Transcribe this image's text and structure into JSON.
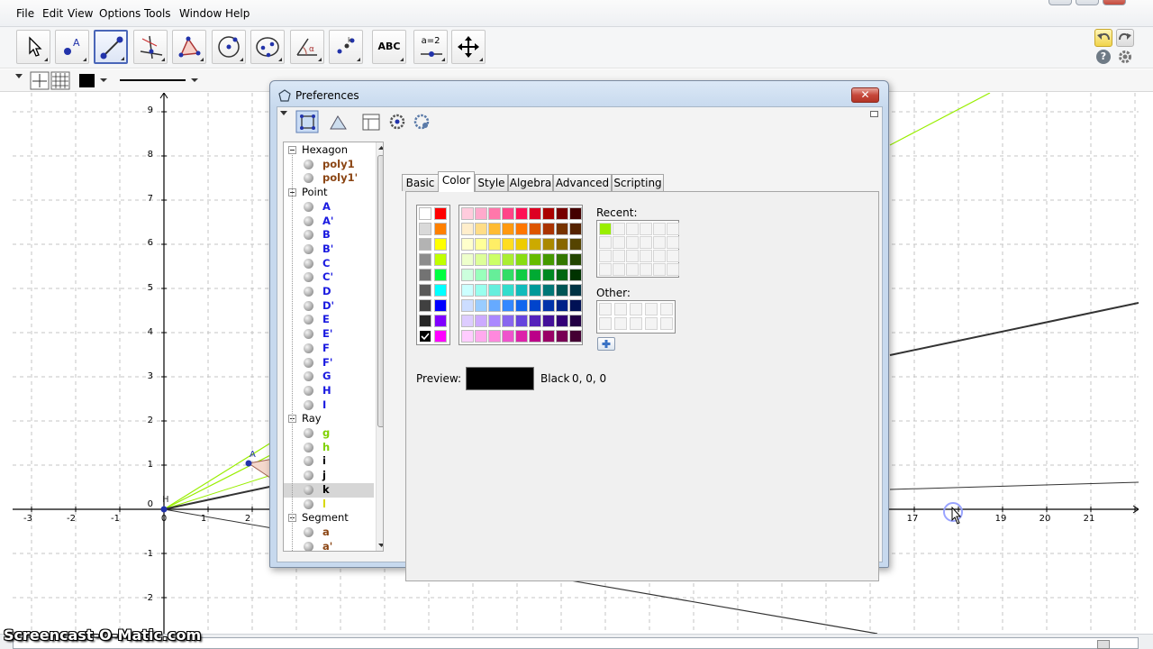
{
  "menu": [
    "File",
    "Edit",
    "View",
    "Options",
    "Tools",
    "Window",
    "Help"
  ],
  "toolbar": {
    "text_tool_label": "ABC",
    "slider_tool_label": "a=2"
  },
  "axes": {
    "x_ticks": [
      "-3",
      "-2",
      "-1",
      "0",
      "1",
      "2",
      "17",
      "19",
      "20",
      "21"
    ],
    "y_ticks": [
      "9",
      "8",
      "7",
      "6",
      "5",
      "4",
      "3",
      "2",
      "1",
      "0",
      "-1",
      "-2"
    ]
  },
  "graph_labels": {
    "point_a": "A",
    "point_h": "H"
  },
  "dialog": {
    "title": "Preferences",
    "close_label": "✕",
    "tabs": [
      "Basic",
      "Color",
      "Style",
      "Algebra",
      "Advanced",
      "Scripting"
    ],
    "active_tab": "Color",
    "tree": [
      {
        "type": "group",
        "label": "Hexagon"
      },
      {
        "type": "item",
        "label": "poly1",
        "color": "#8b4513"
      },
      {
        "type": "item",
        "label": "poly1'",
        "color": "#8b4513"
      },
      {
        "type": "group",
        "label": "Point"
      },
      {
        "type": "item",
        "label": "A",
        "color": "#1a1ae0"
      },
      {
        "type": "item",
        "label": "A'",
        "color": "#1a1ae0"
      },
      {
        "type": "item",
        "label": "B",
        "color": "#1a1ae0"
      },
      {
        "type": "item",
        "label": "B'",
        "color": "#1a1ae0"
      },
      {
        "type": "item",
        "label": "C",
        "color": "#1a1ae0"
      },
      {
        "type": "item",
        "label": "C'",
        "color": "#1a1ae0"
      },
      {
        "type": "item",
        "label": "D",
        "color": "#1a1ae0"
      },
      {
        "type": "item",
        "label": "D'",
        "color": "#1a1ae0"
      },
      {
        "type": "item",
        "label": "E",
        "color": "#1a1ae0"
      },
      {
        "type": "item",
        "label": "E'",
        "color": "#1a1ae0"
      },
      {
        "type": "item",
        "label": "F",
        "color": "#1a1ae0"
      },
      {
        "type": "item",
        "label": "F'",
        "color": "#1a1ae0"
      },
      {
        "type": "item",
        "label": "G",
        "color": "#1a1ae0"
      },
      {
        "type": "item",
        "label": "H",
        "color": "#1a1ae0"
      },
      {
        "type": "item",
        "label": "I",
        "color": "#1a1ae0"
      },
      {
        "type": "group",
        "label": "Ray"
      },
      {
        "type": "item",
        "label": "g",
        "color": "#7fd100"
      },
      {
        "type": "item",
        "label": "h",
        "color": "#7fd100"
      },
      {
        "type": "item",
        "label": "i",
        "color": "#000000"
      },
      {
        "type": "item",
        "label": "j",
        "color": "#000000"
      },
      {
        "type": "item",
        "label": "k",
        "color": "#000000"
      },
      {
        "type": "item",
        "label": "l",
        "color": "#d8d800"
      },
      {
        "type": "group",
        "label": "Segment"
      },
      {
        "type": "item",
        "label": "a",
        "color": "#8b4513"
      },
      {
        "type": "item",
        "label": "a'",
        "color": "#8b4513"
      }
    ],
    "recent_label": "Recent:",
    "other_label": "Other:",
    "preview_label": "Preview:",
    "color_name": "Black",
    "color_rgb": "0, 0, 0",
    "preview_color": "#000000",
    "recent_colors": [
      "#99ee00"
    ],
    "gray_column": [
      "#ffffff",
      "#d9d9d9",
      "#b3b3b3",
      "#8c8c8c",
      "#737373",
      "#595959",
      "#404040",
      "#262626",
      "#000000"
    ],
    "bright_column": [
      "#ff0000",
      "#ff8000",
      "#ffff00",
      "#c0ff00",
      "#00ff40",
      "#00ffff",
      "#0000ff",
      "#8000ff",
      "#ff00ff"
    ],
    "main_palette": [
      [
        "#ffccdd",
        "#ffaacc",
        "#ff77aa",
        "#ff4488",
        "#ff1155",
        "#dd0022",
        "#aa0000",
        "#770000",
        "#440000"
      ],
      [
        "#ffeecc",
        "#ffdd88",
        "#ffbb33",
        "#ff9911",
        "#ff7700",
        "#dd5500",
        "#aa3300",
        "#773300",
        "#552200"
      ],
      [
        "#ffffcc",
        "#ffff99",
        "#ffee66",
        "#ffdd22",
        "#eecc00",
        "#ccaa00",
        "#aa8800",
        "#886600",
        "#554400"
      ],
      [
        "#eeffcc",
        "#ddff99",
        "#ccff66",
        "#aaee33",
        "#88dd11",
        "#66bb00",
        "#449900",
        "#337700",
        "#224400"
      ],
      [
        "#ccffdd",
        "#99ffbb",
        "#66ee99",
        "#33dd66",
        "#11cc44",
        "#00aa33",
        "#008822",
        "#006611",
        "#003300"
      ],
      [
        "#ccffff",
        "#99ffee",
        "#66eedd",
        "#33ddcc",
        "#11bbbb",
        "#009999",
        "#007777",
        "#005555",
        "#003344"
      ],
      [
        "#ccddff",
        "#99ccff",
        "#66aaff",
        "#3388ff",
        "#1166ee",
        "#0044cc",
        "#0033aa",
        "#002288",
        "#001155"
      ],
      [
        "#ddccff",
        "#ccaaff",
        "#aa88ff",
        "#8866ee",
        "#6644dd",
        "#5522bb",
        "#441199",
        "#330077",
        "#220044"
      ],
      [
        "#ffccff",
        "#ffaaee",
        "#ff88dd",
        "#ee55cc",
        "#dd22aa",
        "#bb0088",
        "#990066",
        "#770055",
        "#440033"
      ]
    ]
  }
}
